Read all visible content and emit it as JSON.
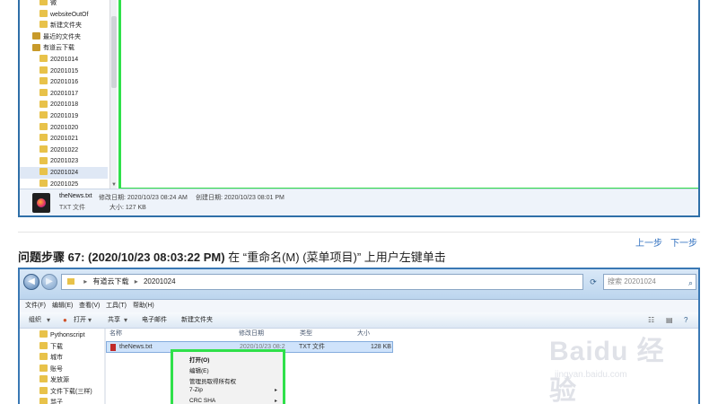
{
  "top_screenshot": {
    "tree_items": [
      {
        "label": "微",
        "sel": false,
        "dark": false
      },
      {
        "label": "websiteOutOf",
        "sel": false,
        "dark": false
      },
      {
        "label": "新建文件夹",
        "sel": false,
        "dark": false
      },
      {
        "label": "最近的文件夹",
        "sel": false,
        "dark": true
      },
      {
        "label": "有道云下载",
        "sel": false,
        "dark": true
      },
      {
        "label": "20201014",
        "sel": false,
        "dark": false
      },
      {
        "label": "20201015",
        "sel": false,
        "dark": false
      },
      {
        "label": "20201016",
        "sel": false,
        "dark": false
      },
      {
        "label": "20201017",
        "sel": false,
        "dark": false
      },
      {
        "label": "20201018",
        "sel": false,
        "dark": false
      },
      {
        "label": "20201019",
        "sel": false,
        "dark": false
      },
      {
        "label": "20201020",
        "sel": false,
        "dark": false
      },
      {
        "label": "20201021",
        "sel": false,
        "dark": false
      },
      {
        "label": "20201022",
        "sel": false,
        "dark": false
      },
      {
        "label": "20201023",
        "sel": false,
        "dark": false
      },
      {
        "label": "20201024",
        "sel": true,
        "dark": false
      },
      {
        "label": "20201025",
        "sel": false,
        "dark": false
      }
    ],
    "details": {
      "file_name": "theNews.txt",
      "file_type": "TXT 文件",
      "modified": "修改日期: 2020/10/23 08:24 AM",
      "size": "大小: 127 KB",
      "created": "创建日期: 2020/10/23 08:01 PM"
    }
  },
  "nav": {
    "prev": "上一步",
    "next": "下一步"
  },
  "step": {
    "prefix": "问题步骤",
    "number_time": "67: (2020/10/23 08:03:22 PM)",
    "description": "在 “重命名(M) (菜单项目)” 上用户左键单击"
  },
  "bottom_screenshot": {
    "address": {
      "part1": "有道云下载",
      "part2": "20201024"
    },
    "search_placeholder": "搜索 20201024",
    "menubar": [
      "文件(F)",
      "编辑(E)",
      "查看(V)",
      "工具(T)",
      "帮助(H)"
    ],
    "toolbar": {
      "organize": "组织",
      "open": "打开",
      "share": "共享",
      "email": "电子邮件",
      "new_folder": "新建文件夹"
    },
    "tree_items": [
      "Pythonscript",
      "下载",
      "城市",
      "账号",
      "发放源",
      "文件下载(三样)",
      "骂子"
    ],
    "columns": {
      "name": "名称",
      "modified": "修改日期",
      "type": "类型",
      "size": "大小"
    },
    "file_row": {
      "name": "theNews.txt",
      "modified": "2020/10/23 08:2",
      "type": "TXT 文件",
      "size": "128 KB"
    },
    "context_menu": [
      "打开(O)",
      "编辑(E)",
      "管理员取得所有权",
      "7-Zip",
      "CRC SHA"
    ]
  },
  "watermark": {
    "big": "Baidu 经验",
    "small": "jingyan.baidu.com"
  }
}
